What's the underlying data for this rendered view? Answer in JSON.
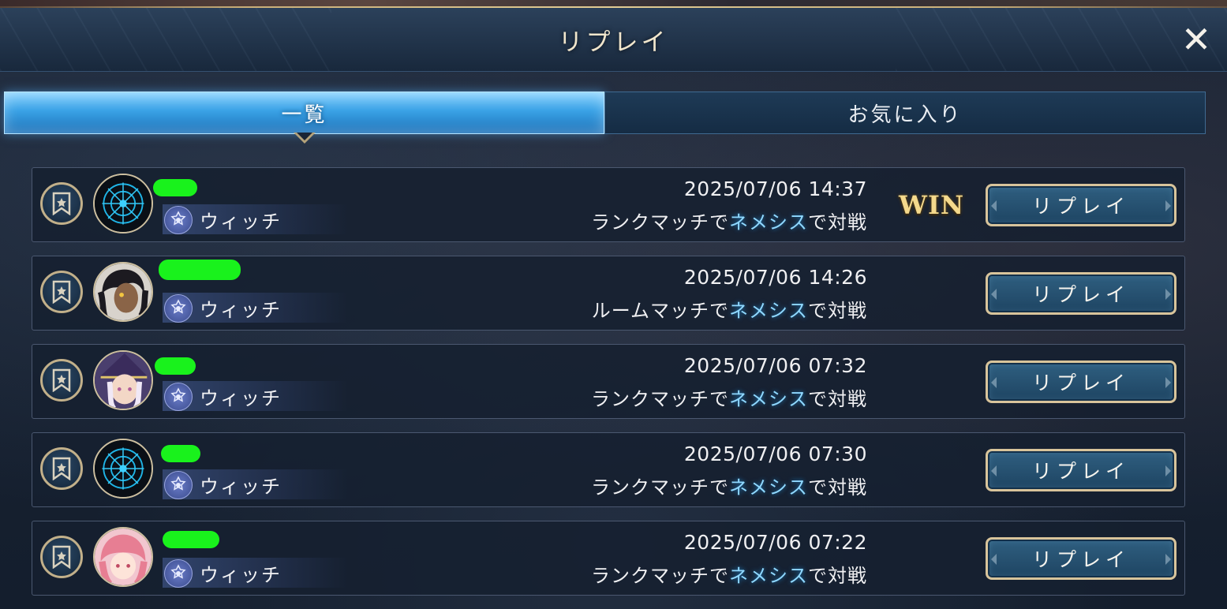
{
  "header": {
    "title": "リプレイ",
    "close_label": "✕"
  },
  "tabs": [
    {
      "label": "一覧",
      "active": true
    },
    {
      "label": "お気に入り",
      "active": false
    }
  ],
  "replays": [
    {
      "name": "",
      "avatar_icon": "emblem-avatar",
      "class_name": "ウィッチ",
      "datetime": "2025/07/06 14:37",
      "mode_prefix": "ランクマッチで",
      "deck": "ネメシス",
      "mode_suffix": "で対戦",
      "result": "WIN",
      "button_label": "リプレイ"
    },
    {
      "name": "",
      "avatar_icon": "dark-haired-character-avatar",
      "class_name": "ウィッチ",
      "datetime": "2025/07/06 14:26",
      "mode_prefix": "ルームマッチで",
      "deck": "ネメシス",
      "mode_suffix": "で対戦",
      "result": "",
      "button_label": "リプレイ"
    },
    {
      "name": "",
      "avatar_icon": "witch-character-avatar",
      "class_name": "ウィッチ",
      "datetime": "2025/07/06 07:32",
      "mode_prefix": "ランクマッチで",
      "deck": "ネメシス",
      "mode_suffix": "で対戦",
      "result": "",
      "button_label": "リプレイ"
    },
    {
      "name": "",
      "avatar_icon": "emblem-avatar",
      "class_name": "ウィッチ",
      "datetime": "2025/07/06 07:30",
      "mode_prefix": "ランクマッチで",
      "deck": "ネメシス",
      "mode_suffix": "で対戦",
      "result": "",
      "button_label": "リプレイ"
    },
    {
      "name": "",
      "avatar_icon": "pink-haired-character-avatar",
      "class_name": "ウィッチ",
      "datetime": "2025/07/06 07:22",
      "mode_prefix": "ランクマッチで",
      "deck": "ネメシス",
      "mode_suffix": "で対戦",
      "result": "",
      "button_label": "リプレイ"
    }
  ],
  "colors": {
    "accent_blue": "#3aa2e6",
    "gold": "#d8c49b",
    "deck_highlight": "#8fd8ff",
    "win": "#f4d98c"
  }
}
